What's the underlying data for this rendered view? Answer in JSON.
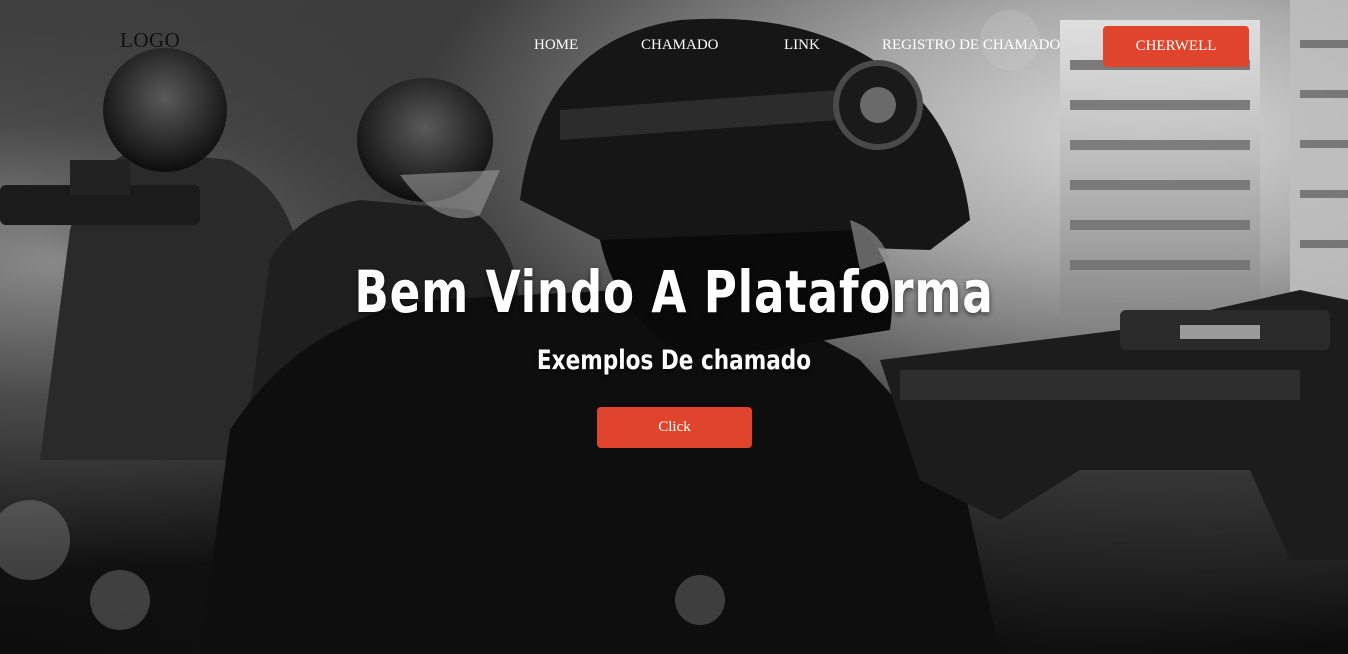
{
  "nav": {
    "logo": "LOGO",
    "links": [
      "HOME",
      "CHAMADO",
      "LINK",
      "REGISTRO DE CHAMADO"
    ],
    "cta_label": "CHERWELL"
  },
  "hero": {
    "title": "Bem Vindo A Plataforma",
    "subtitle": "Exemplos De chamado",
    "cta_label": "Click"
  },
  "colors": {
    "accent": "#e0442c",
    "text": "#ffffff",
    "logo": "#111111"
  },
  "background": {
    "image": "grayscale-soldiers-artwork"
  }
}
